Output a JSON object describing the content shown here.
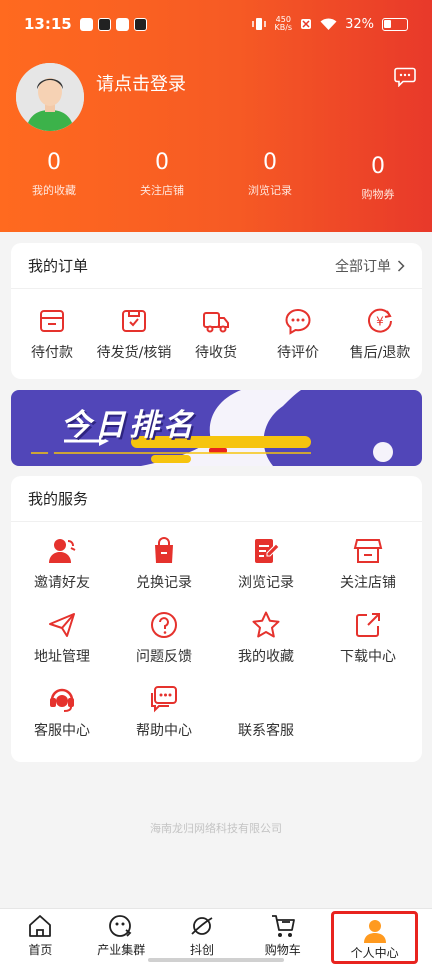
{
  "status_bar": {
    "time": "13:15",
    "net_speed_top": "450",
    "net_speed_bottom": "KB/s",
    "battery": "32%"
  },
  "profile": {
    "login_text": "请点击登录"
  },
  "stats": [
    {
      "value": "0",
      "label": "我的收藏"
    },
    {
      "value": "0",
      "label": "关注店铺"
    },
    {
      "value": "0",
      "label": "浏览记录"
    },
    {
      "value": "0",
      "label": "购物券"
    }
  ],
  "orders": {
    "title": "我的订单",
    "all_label": "全部订单",
    "items": [
      {
        "label": "待付款",
        "icon": "wallet-icon"
      },
      {
        "label": "待发货/核销",
        "icon": "package-check-icon"
      },
      {
        "label": "待收货",
        "icon": "truck-icon"
      },
      {
        "label": "待评价",
        "icon": "comment-icon"
      },
      {
        "label": "售后/退款",
        "icon": "refund-icon"
      }
    ]
  },
  "banner": {
    "text": "今日排名"
  },
  "services": {
    "title": "我的服务",
    "items": [
      {
        "label": "邀请好友",
        "icon": "invite-friend-icon"
      },
      {
        "label": "兑换记录",
        "icon": "shopping-bag-icon"
      },
      {
        "label": "浏览记录",
        "icon": "document-edit-icon"
      },
      {
        "label": "关注店铺",
        "icon": "store-icon"
      },
      {
        "label": "地址管理",
        "icon": "paper-plane-icon"
      },
      {
        "label": "问题反馈",
        "icon": "question-icon"
      },
      {
        "label": "我的收藏",
        "icon": "star-icon"
      },
      {
        "label": "下载中心",
        "icon": "share-icon"
      },
      {
        "label": "客服中心",
        "icon": "headset-icon"
      },
      {
        "label": "帮助中心",
        "icon": "chat-bubbles-icon"
      },
      {
        "label": "联系客服",
        "icon": ""
      }
    ]
  },
  "footer": {
    "company": "海南龙归网络科技有限公司"
  },
  "tabbar": [
    {
      "label": "首页",
      "icon": "home-icon"
    },
    {
      "label": "产业集群",
      "icon": "cluster-icon"
    },
    {
      "label": "抖创",
      "icon": "planet-icon"
    },
    {
      "label": "购物车",
      "icon": "cart-icon"
    },
    {
      "label": "个人中心",
      "icon": "person-icon",
      "active": true
    }
  ],
  "colors": {
    "accent": "#e8231f",
    "header_start": "#ff6a1f",
    "header_end": "#e8392a",
    "icon_red": "#e5322d"
  }
}
